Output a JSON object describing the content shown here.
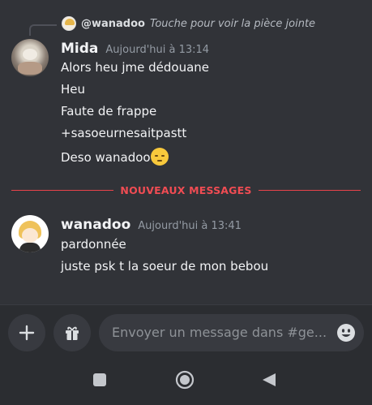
{
  "reply": {
    "username": "@wanadoo",
    "preview": "Touche pour voir la pièce jointe"
  },
  "messages": [
    {
      "username": "Mida",
      "time": "Aujourd'hui à 13:14",
      "lines": [
        "Alors heu jme dédouane",
        "Heu",
        "Faute de frappe",
        "+sasoeurnesaitpastt",
        "Deso wanadoo"
      ],
      "trailing_emoji": "pensive-face"
    },
    {
      "username": "wanadoo",
      "time": "Aujourd'hui à 13:41",
      "lines": [
        "pardonnée",
        "juste psk t la soeur de mon bebou"
      ]
    }
  ],
  "divider": {
    "label": "NOUVEAUX MESSAGES",
    "color": "#f04c53"
  },
  "composer": {
    "placeholder": "Envoyer un message dans #ge...",
    "icons": [
      "plus-icon",
      "gift-icon",
      "emoji-icon"
    ]
  },
  "nav_icons": [
    "recent-apps-icon",
    "home-icon",
    "back-icon"
  ],
  "colors": {
    "background": "#313338",
    "composer": "#2b2d31",
    "accent_red": "#f04c53"
  }
}
